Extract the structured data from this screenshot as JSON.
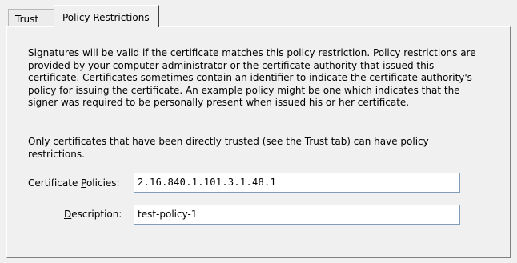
{
  "tabs": [
    {
      "label": "Trust",
      "selected": false
    },
    {
      "label": "Policy Restrictions",
      "selected": true
    }
  ],
  "content": {
    "paragraph1": "Signatures will be valid if the certificate matches this policy restriction. Policy restrictions are provided by your computer administrator or the certificate authority that issued this certificate. Certificates sometimes contain an identifier to indicate the certificate authority's policy for issuing the certificate. An example policy might be one which indicates that the signer was required to be personally present when issued his or her certificate.",
    "paragraph2": "Only certificates that have been directly trusted (see the Trust tab) can have policy restrictions."
  },
  "fields": {
    "policies": {
      "label_pre": "Certificate ",
      "label_mnemonic": "P",
      "label_post": "olicies:",
      "value": "2.16.840.1.101.3.1.48.1"
    },
    "description": {
      "label_pre": "",
      "label_mnemonic": "D",
      "label_post": "escription:",
      "value": "test-policy-1"
    }
  },
  "colors": {
    "window_bg": "#f0f0f0",
    "field_border": "#7f9db9"
  }
}
